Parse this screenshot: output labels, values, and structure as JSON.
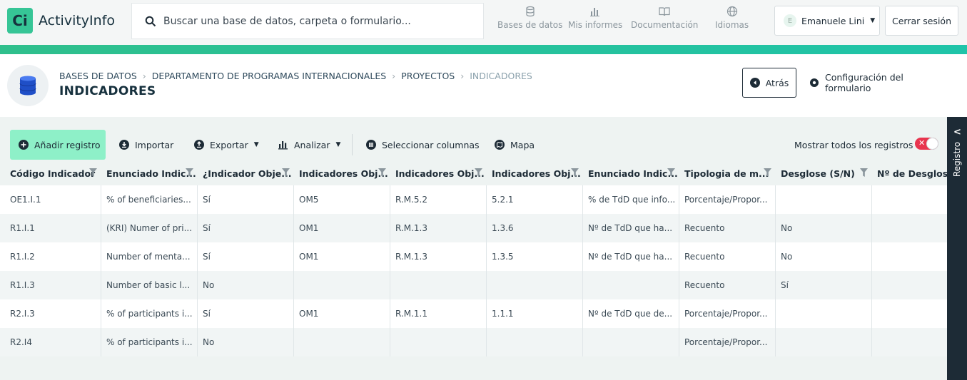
{
  "app": {
    "logo_letter": "Ci",
    "name": "ActivityInfo"
  },
  "search": {
    "placeholder": "Buscar una base de datos, carpeta o formulario..."
  },
  "nav": [
    {
      "label": "Bases de datos",
      "icon": "database-icon"
    },
    {
      "label": "Mis informes",
      "icon": "bar-chart-icon"
    },
    {
      "label": "Documentación",
      "icon": "book-icon"
    },
    {
      "label": "Idiomas",
      "icon": "globe-icon"
    }
  ],
  "user": {
    "initial": "E",
    "name": "Emanuele Lini",
    "logout_label": "Cerrar sesión"
  },
  "breadcrumb": [
    "BASES DE DATOS",
    "DEPARTAMENTO DE PROGRAMAS INTERNACIONALES",
    "PROYECTOS",
    "INDICADORES"
  ],
  "page_title": "INDICADORES",
  "header_actions": {
    "back_label": "Atrás",
    "config_label": "Configuración del formulario"
  },
  "toolbar": {
    "add_label": "Añadir registro",
    "import_label": "Importar",
    "export_label": "Exportar",
    "analyze_label": "Analizar",
    "columns_label": "Seleccionar columnas",
    "map_label": "Mapa",
    "show_all_label": "Mostrar todos los registros",
    "show_all_on": false
  },
  "side_panel": {
    "label": "Registro"
  },
  "colors": {
    "accent": "#36c596",
    "add_button": "#8ef0c8",
    "toggle": "#e8344e",
    "dark": "#1d2b36"
  },
  "table": {
    "columns": [
      "Código Indicador",
      "Enunciado Indic...",
      "¿Indicador Obje...",
      "Indicadores Obj...",
      "Indicadores Obj...",
      "Indicadores Obj...",
      "Enunciado Indic...",
      "Tipologia de m...",
      "Desglose (S/N)",
      "Nº de Desgloses"
    ],
    "rows": [
      [
        "OE1.I.1",
        "% of beneficiaries...",
        "Sí",
        "OM5",
        "R.M.5.2",
        "5.2.1",
        "% de TdD que info...",
        "Porcentaje/Propor...",
        "",
        ""
      ],
      [
        "R1.I.1",
        "(KRI) Numer of pri...",
        "Sí",
        "OM1",
        "R.M.1.3",
        "1.3.6",
        "Nº de TdD que ha...",
        "Recuento",
        "No",
        ""
      ],
      [
        "R1.I.2",
        "Number of menta...",
        "Sí",
        "OM1",
        "R.M.1.3",
        "1.3.5",
        "Nº de TdD que ha...",
        "Recuento",
        "No",
        ""
      ],
      [
        "R1.I.3",
        "Number of basic l...",
        "No",
        "",
        "",
        "",
        "",
        "Recuento",
        "Sí",
        ""
      ],
      [
        "R2.I.3",
        "% of participants i...",
        "Sí",
        "OM1",
        "R.M.1.1",
        "1.1.1",
        "Nº de TdD que de...",
        "Porcentaje/Propor...",
        "",
        ""
      ],
      [
        "R2.I4",
        "% of participants i...",
        "No",
        "",
        "",
        "",
        "",
        "Porcentaje/Propor...",
        "",
        ""
      ]
    ]
  }
}
